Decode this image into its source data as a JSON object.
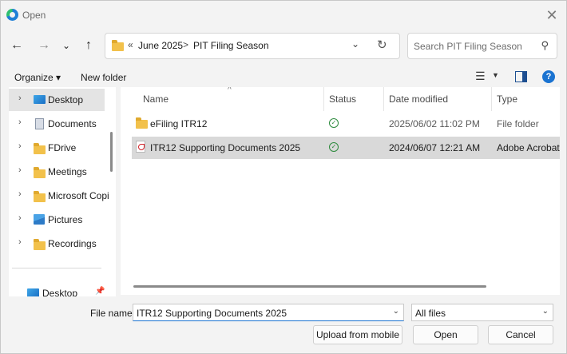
{
  "window": {
    "title": "Open"
  },
  "address_bar": {
    "overflow": "«",
    "crumbs": [
      "June 2025",
      "PIT Filing Season"
    ],
    "separator": ">"
  },
  "search": {
    "placeholder": "Search PIT Filing Season"
  },
  "toolbar": {
    "organize": "Organize",
    "new_folder": "New folder"
  },
  "sidebar": {
    "items": [
      {
        "label": "Desktop",
        "icon": "desktop-icon",
        "selected": true
      },
      {
        "label": "Documents",
        "icon": "documents-icon"
      },
      {
        "label": "FDrive",
        "icon": "folder-icon"
      },
      {
        "label": "Meetings",
        "icon": "folder-icon"
      },
      {
        "label": "Microsoft Copi",
        "icon": "folder-icon"
      },
      {
        "label": "Pictures",
        "icon": "pictures-icon"
      },
      {
        "label": "Recordings",
        "icon": "folder-icon"
      }
    ],
    "pinned": {
      "label": "Desktop",
      "icon": "desktop-icon"
    }
  },
  "file_list": {
    "columns": [
      "Name",
      "Status",
      "Date modified",
      "Type"
    ],
    "rows": [
      {
        "name": "eFiling ITR12",
        "status": "synced",
        "date": "2025/06/02 11:02 PM",
        "type": "File folder",
        "icon": "folder-icon"
      },
      {
        "name": "ITR12 Supporting Documents 2025",
        "status": "synced",
        "date": "2024/06/07 12:21 AM",
        "type": "Adobe Acrobat",
        "icon": "pdf-icon",
        "selected": true
      }
    ]
  },
  "footer": {
    "file_name_label": "File name:",
    "file_name_value": "ITR12 Supporting Documents 2025",
    "file_type": "All files",
    "upload_button": "Upload from mobile",
    "open_button": "Open",
    "cancel_button": "Cancel"
  }
}
